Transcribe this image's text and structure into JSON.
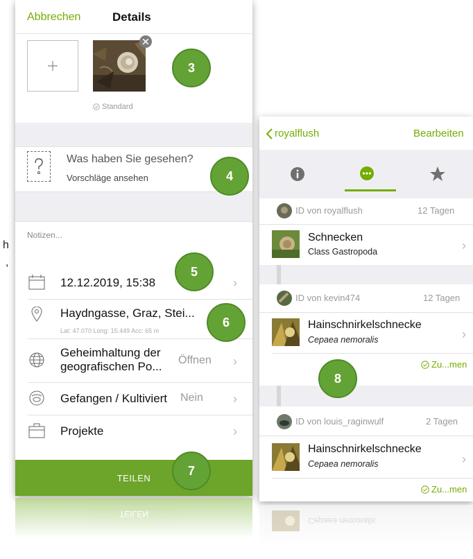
{
  "left": {
    "cancel_label": "Abbrechen",
    "title": "Details",
    "standard_label": "Standard",
    "species_prompt": "Was haben Sie gesehen?",
    "suggestions_label": "Vorschläge ansehen",
    "notes_placeholder": "Notizen...",
    "date_value": "12.12.2019, 15:38",
    "location_value": "Haydngasse, Graz, Stei...",
    "location_coords": "Lat: 47.070  Long: 15.449  Acc: 65 m",
    "geoprivacy_label": "Geheimhaltung der geografischen Po...",
    "geoprivacy_value": "Öffnen",
    "captive_label": "Gefangen / Kultiviert",
    "captive_value": "Nein",
    "projects_label": "Projekte",
    "share_label": "TEILEN",
    "side_fragment_1": "h",
    "side_fragment_2": ","
  },
  "markers": [
    "3",
    "4",
    "5",
    "6",
    "7",
    "8"
  ],
  "right": {
    "back_label": "royalflush",
    "edit_label": "Bearbeiten",
    "identifications": [
      {
        "id_text": "ID von royalflush",
        "age": "12 Tagen",
        "taxon": "Schnecken",
        "sub": "Class Gastropoda",
        "agree": ""
      },
      {
        "id_text": "ID von kevin474",
        "age": "12 Tagen",
        "taxon": "Hainschnirkelschnecke",
        "sub": "Cepaea nemoralis",
        "agree": "Zu...men"
      },
      {
        "id_text": "ID von louis_raginwulf",
        "age": "2 Tagen",
        "taxon": "Hainschnirkelschnecke",
        "sub": "Cepaea nemoralis",
        "agree": "Zu...men"
      }
    ]
  },
  "reflection": {
    "share_label": "TEILEN",
    "sub_text": "Cepaea nemoralis"
  },
  "colors": {
    "accent": "#74ac00",
    "share_button": "#6da42a",
    "marker": "#63a335",
    "band": "#efeff3"
  },
  "icons": [
    "plus-icon",
    "close-icon",
    "check-circle-icon",
    "question-icon",
    "calendar-icon",
    "location-pin-icon",
    "globe-icon",
    "captive-icon",
    "briefcase-icon",
    "chevron-right-icon",
    "chevron-left-icon",
    "info-icon",
    "chat-icon",
    "star-icon"
  ]
}
